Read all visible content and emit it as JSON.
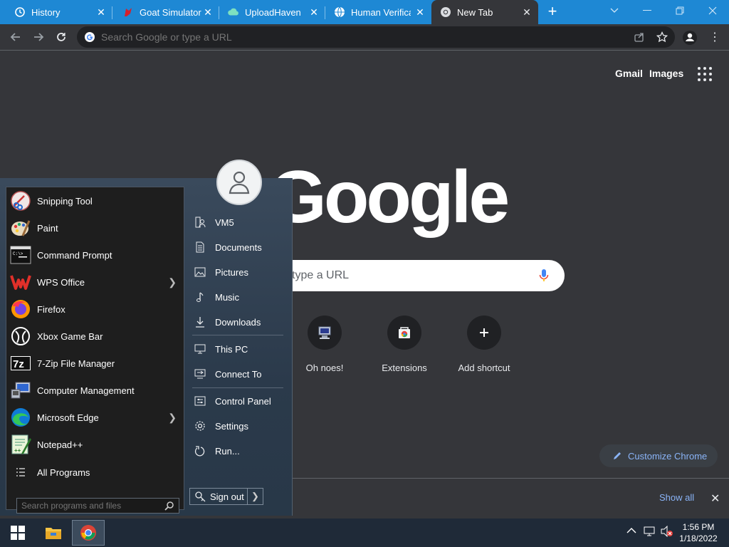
{
  "browser": {
    "tabs": [
      {
        "title": "History",
        "icon": "history-icon",
        "active": false
      },
      {
        "title": "Goat Simulator",
        "icon": "goat-favicon",
        "active": false
      },
      {
        "title": "UploadHaven -",
        "icon": "cloud-favicon",
        "active": false
      },
      {
        "title": "Human Verificat",
        "icon": "globe-favicon",
        "active": false
      },
      {
        "title": "New Tab",
        "icon": "chrome-favicon",
        "active": true
      }
    ],
    "omnibox_placeholder": "Search Google or type a URL"
  },
  "ntp": {
    "links": {
      "gmail": "Gmail",
      "images": "Images"
    },
    "logo_text": "Google",
    "search_placeholder": "Search Google or type a URL",
    "search_visible_fragment": "type a URL",
    "shortcuts": [
      {
        "label": "Oh noes!",
        "icon": "computer-favicon"
      },
      {
        "label": "Extensions",
        "icon": "chrome-web-store-favicon"
      },
      {
        "label": "Add shortcut",
        "icon": "plus-icon"
      }
    ],
    "customize_label": "Customize Chrome",
    "downloads": {
      "show_all": "Show all"
    }
  },
  "start_menu": {
    "programs": [
      {
        "label": "Snipping Tool",
        "icon": "snipping-tool-icon",
        "submenu": false
      },
      {
        "label": "Paint",
        "icon": "paint-icon",
        "submenu": false
      },
      {
        "label": "Command Prompt",
        "icon": "cmd-icon",
        "submenu": false
      },
      {
        "label": "WPS Office",
        "icon": "wps-icon",
        "submenu": true
      },
      {
        "label": "Firefox",
        "icon": "firefox-icon",
        "submenu": false
      },
      {
        "label": "Xbox Game Bar",
        "icon": "xbox-icon",
        "submenu": false
      },
      {
        "label": "7-Zip File Manager",
        "icon": "7zip-icon",
        "submenu": false
      },
      {
        "label": "Computer Management",
        "icon": "computer-management-icon",
        "submenu": false
      },
      {
        "label": "Microsoft Edge",
        "icon": "edge-icon",
        "submenu": true
      },
      {
        "label": "Notepad++",
        "icon": "notepad-plus-plus-icon",
        "submenu": false
      }
    ],
    "all_programs": "All Programs",
    "search_placeholder": "Search programs and files",
    "places": [
      {
        "label": "VM5",
        "icon": "user-folder-icon"
      },
      {
        "label": "Documents",
        "icon": "documents-icon"
      },
      {
        "label": "Pictures",
        "icon": "pictures-icon"
      },
      {
        "label": "Music",
        "icon": "music-icon"
      },
      {
        "label": "Downloads",
        "icon": "downloads-icon"
      },
      {
        "label": "This PC",
        "icon": "this-pc-icon"
      },
      {
        "label": "Connect To",
        "icon": "connect-icon"
      },
      {
        "label": "Control Panel",
        "icon": "control-panel-icon"
      },
      {
        "label": "Settings",
        "icon": "settings-icon"
      },
      {
        "label": "Run...",
        "icon": "run-icon"
      }
    ],
    "sign_out": "Sign out"
  },
  "taskbar": {
    "time": "1:56 PM",
    "date": "1/18/2022"
  },
  "colors": {
    "tabstrip": "#1e88d4",
    "page_bg": "#35363a",
    "accent_link": "#8ab4f8"
  }
}
